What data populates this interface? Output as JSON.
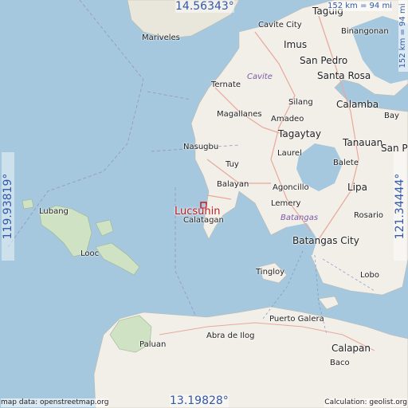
{
  "location": {
    "name": "Lucsuhin"
  },
  "coordinates": {
    "top": "14.56343°",
    "bottom": "13.19828°",
    "left": "119.93819°",
    "right": "121.34444°"
  },
  "scale": {
    "top": "152 km = 94 mi",
    "right": "152 km = 94 mi"
  },
  "attribution": {
    "left": "map data: openstreetmap.org",
    "right": "Calculation: geolist.org"
  },
  "places": {
    "taguig": "Taguig",
    "cavite_city": "Cavite City",
    "binangonan": "Binangonan",
    "mariveles": "Mariveles",
    "imus": "Imus",
    "san_pedro": "San Pedro",
    "cavite": "Cavite",
    "santa_rosa": "Santa Rosa",
    "ternate": "Ternate",
    "silang": "Silang",
    "calamba": "Calamba",
    "magallanes": "Magallanes",
    "amadeo": "Amadeo",
    "bay": "Bay",
    "tagaytay": "Tagaytay",
    "nasugbu": "Nasugbu",
    "tanauan": "Tanauan",
    "san_pa": "San Pa",
    "laurel": "Laurel",
    "tuy": "Tuy",
    "balete": "Balete",
    "balayan": "Balayan",
    "agoncillo": "Agoncillo",
    "lipa": "Lipa",
    "lubang": "Lubang",
    "lemery": "Lemery",
    "calatagan": "Calatagan",
    "batangas": "Batangas",
    "rosario": "Rosario",
    "batangas_city": "Batangas City",
    "looc": "Looc",
    "tingloy": "Tingloy",
    "lobo": "Lobo",
    "puerto_galera": "Puerto Galera",
    "abra_de_ilog": "Abra de Ilog",
    "paluan": "Paluan",
    "calapan": "Calapan",
    "baco": "Baco"
  },
  "colors": {
    "water": "#a5c8de",
    "land": "#f2efe9",
    "marker": "#c41a1a"
  }
}
